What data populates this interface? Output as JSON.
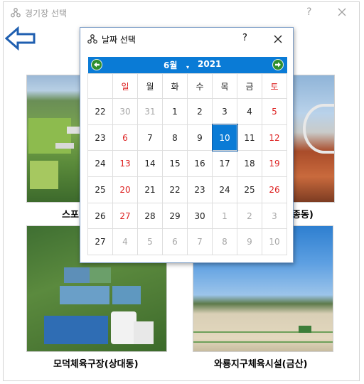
{
  "outer_window": {
    "title": "경기장 선택",
    "help": "?"
  },
  "facilities": [
    {
      "label": "스포",
      "caption_right": "종동)"
    },
    {
      "label": "모덕체육구장(상대동)"
    },
    {
      "label": "와룡지구체육시설(금산)"
    }
  ],
  "date_dialog": {
    "title": "날짜 선택",
    "help": "?",
    "month": "6월",
    "year": "2021",
    "weekday_headers": [
      "일",
      "월",
      "화",
      "수",
      "목",
      "금",
      "토"
    ],
    "weeks": [
      {
        "week": "22",
        "days": [
          "30",
          "31",
          "1",
          "2",
          "3",
          "4",
          "5"
        ]
      },
      {
        "week": "23",
        "days": [
          "6",
          "7",
          "8",
          "9",
          "10",
          "11",
          "12"
        ]
      },
      {
        "week": "24",
        "days": [
          "13",
          "14",
          "15",
          "16",
          "17",
          "18",
          "19"
        ]
      },
      {
        "week": "25",
        "days": [
          "20",
          "21",
          "22",
          "23",
          "24",
          "25",
          "26"
        ]
      },
      {
        "week": "26",
        "days": [
          "27",
          "28",
          "29",
          "30",
          "1",
          "2",
          "3"
        ]
      },
      {
        "week": "27",
        "days": [
          "4",
          "5",
          "6",
          "7",
          "8",
          "9",
          "10"
        ]
      }
    ],
    "selected_day": "10"
  },
  "colors": {
    "accent": "#0a7bd6",
    "sunday_saturday": "#dd2222",
    "other_month": "#a8a8a8",
    "nav_button": "#2f8f2f"
  }
}
